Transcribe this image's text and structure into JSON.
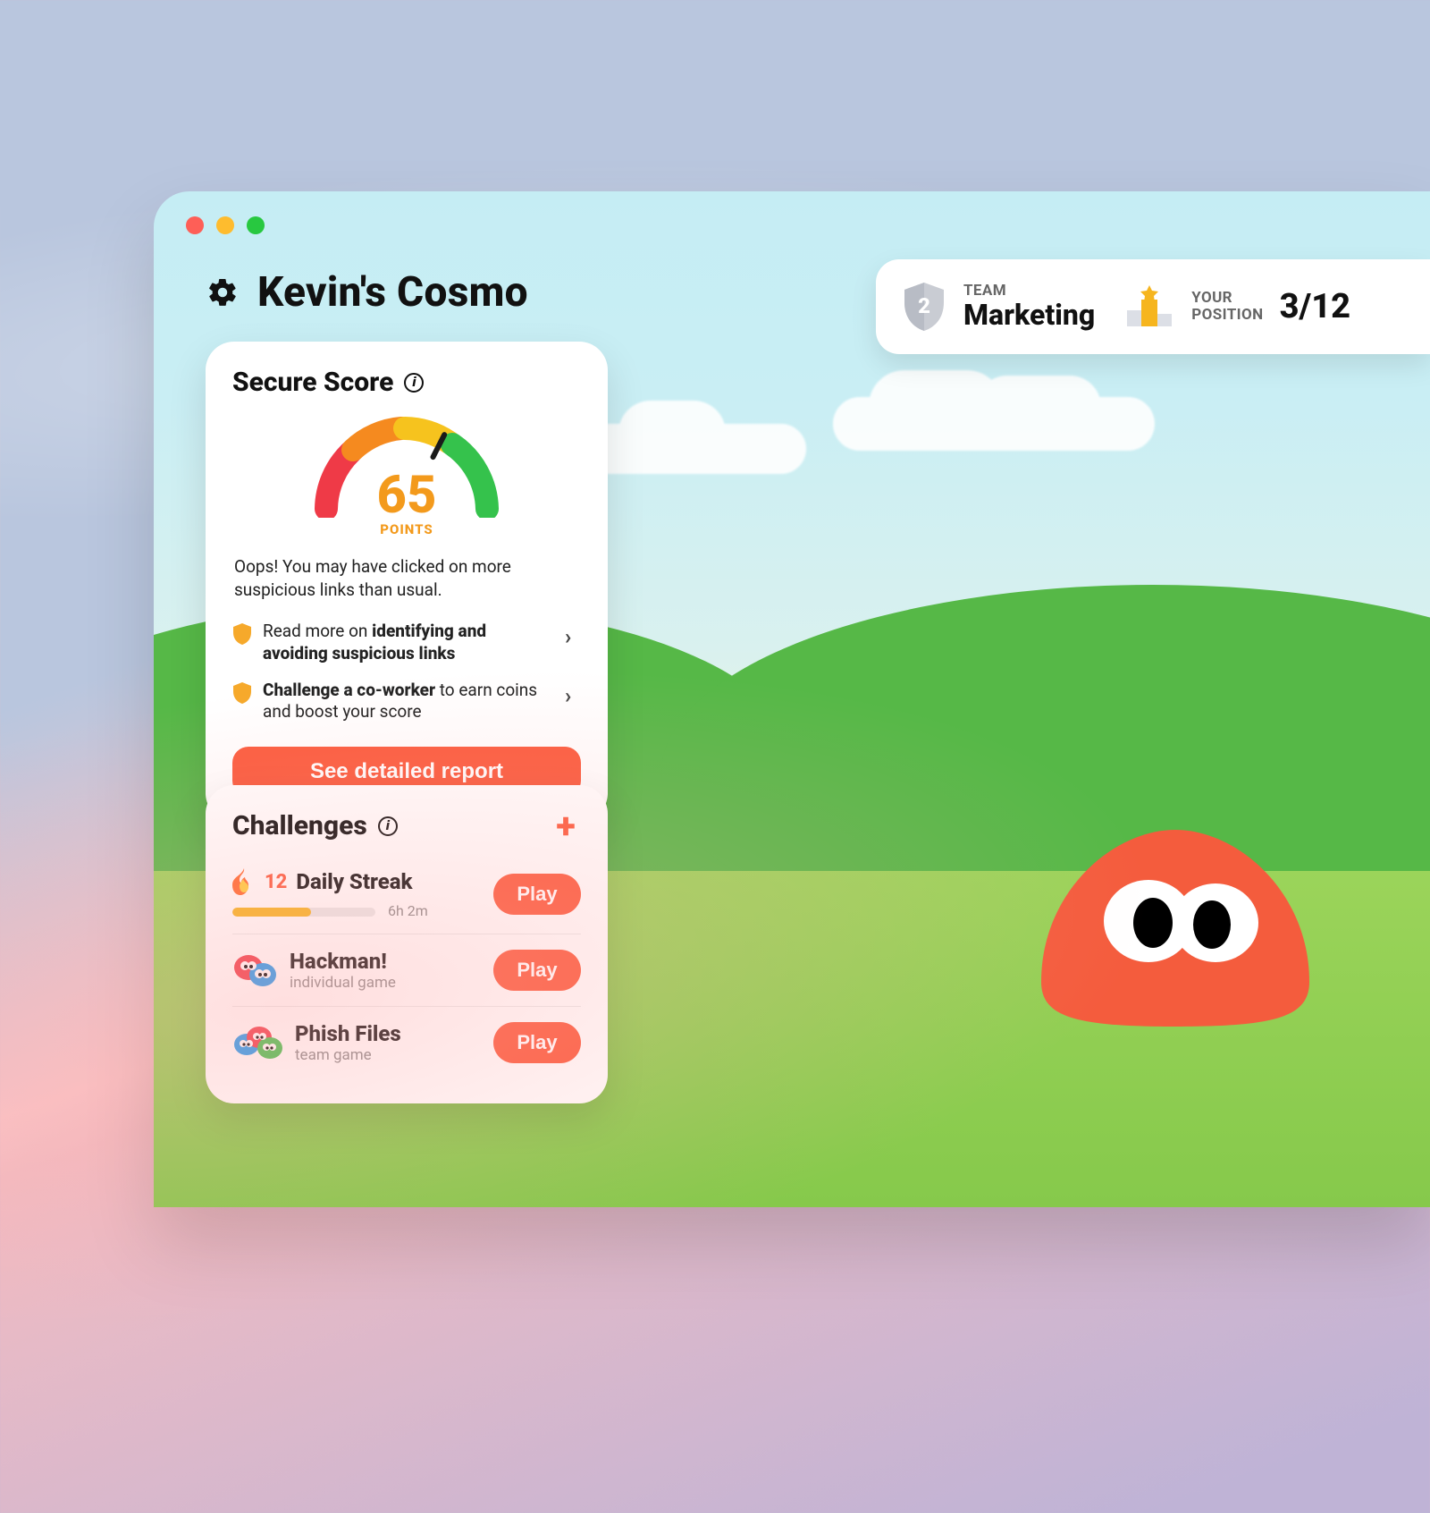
{
  "header": {
    "title": "Kevin's Cosmo"
  },
  "team_pill": {
    "team_label": "TEAM",
    "team_name": "Marketing",
    "team_badge_number": "2",
    "position_label_top": "YOUR",
    "position_label_bottom": "POSITION",
    "position_value": "3/12"
  },
  "score_card": {
    "title": "Secure Score",
    "value": "65",
    "unit": "POINTS",
    "message": "Oops! You may have clicked on more suspicious links than usual.",
    "suggestions": [
      {
        "pre": "Read more on ",
        "bold": "identifying and avoiding suspicious links",
        "post": ""
      },
      {
        "pre": "",
        "bold": "Challenge a co-worker",
        "post": " to earn coins and boost your score"
      }
    ],
    "button": "See detailed report"
  },
  "challenges": {
    "title": "Challenges",
    "items": [
      {
        "name": "Daily Streak",
        "subtitle": "",
        "streak": "12",
        "progress_pct": 55,
        "time_left": "6h 2m",
        "play": "Play",
        "icon": "fire"
      },
      {
        "name": "Hackman!",
        "subtitle": "individual game",
        "play": "Play",
        "icon": "duo"
      },
      {
        "name": "Phish Files",
        "subtitle": "team game",
        "play": "Play",
        "icon": "trio"
      }
    ]
  },
  "colors": {
    "accent": "#fb5c3e",
    "amber": "#f39a1c"
  },
  "chart_data": {
    "type": "gauge",
    "title": "Secure Score",
    "value": 65,
    "value_label": "65",
    "unit": "POINTS",
    "range": [
      0,
      100
    ],
    "segments": [
      {
        "name": "red",
        "range": [
          0,
          25
        ],
        "color": "#ef3a47"
      },
      {
        "name": "orange",
        "range": [
          25,
          50
        ],
        "color": "#f58a1f"
      },
      {
        "name": "yellow",
        "range": [
          50,
          70
        ],
        "color": "#f6c31e"
      },
      {
        "name": "green",
        "range": [
          70,
          100
        ],
        "color": "#35c24c"
      }
    ]
  }
}
